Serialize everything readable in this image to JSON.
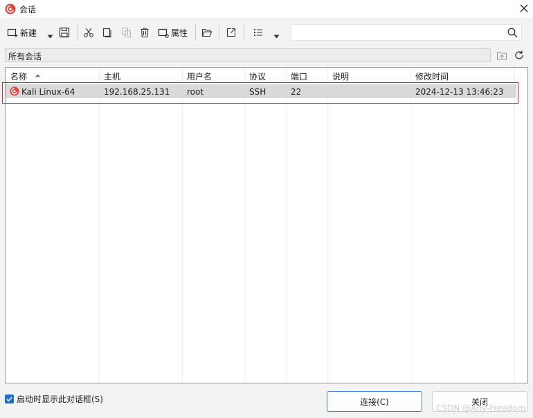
{
  "window": {
    "title": "会话"
  },
  "toolbar": {
    "new_label": "新建",
    "properties_label": "属性",
    "search_value": ""
  },
  "path": {
    "label": "所有会话"
  },
  "columns": [
    "名称",
    "主机",
    "用户名",
    "协议",
    "端口",
    "说明",
    "修改时间"
  ],
  "sessions": [
    {
      "name": "Kali Linux-64",
      "host": "192.168.25.131",
      "user": "root",
      "protocol": "SSH",
      "port": "22",
      "description": "",
      "modified": "2024-12-13 13:46:23"
    }
  ],
  "footer": {
    "show_on_startup_label": "启动时显示此对话框(S)",
    "show_on_startup_checked": true,
    "connect_label": "连接(C)",
    "close_label": "关闭"
  },
  "watermark": "CSDN @Any-Freedom",
  "colors": {
    "accent": "#1f6fd1",
    "highlight_border": "#e0262b",
    "selected_row": "#d9d9d9"
  }
}
